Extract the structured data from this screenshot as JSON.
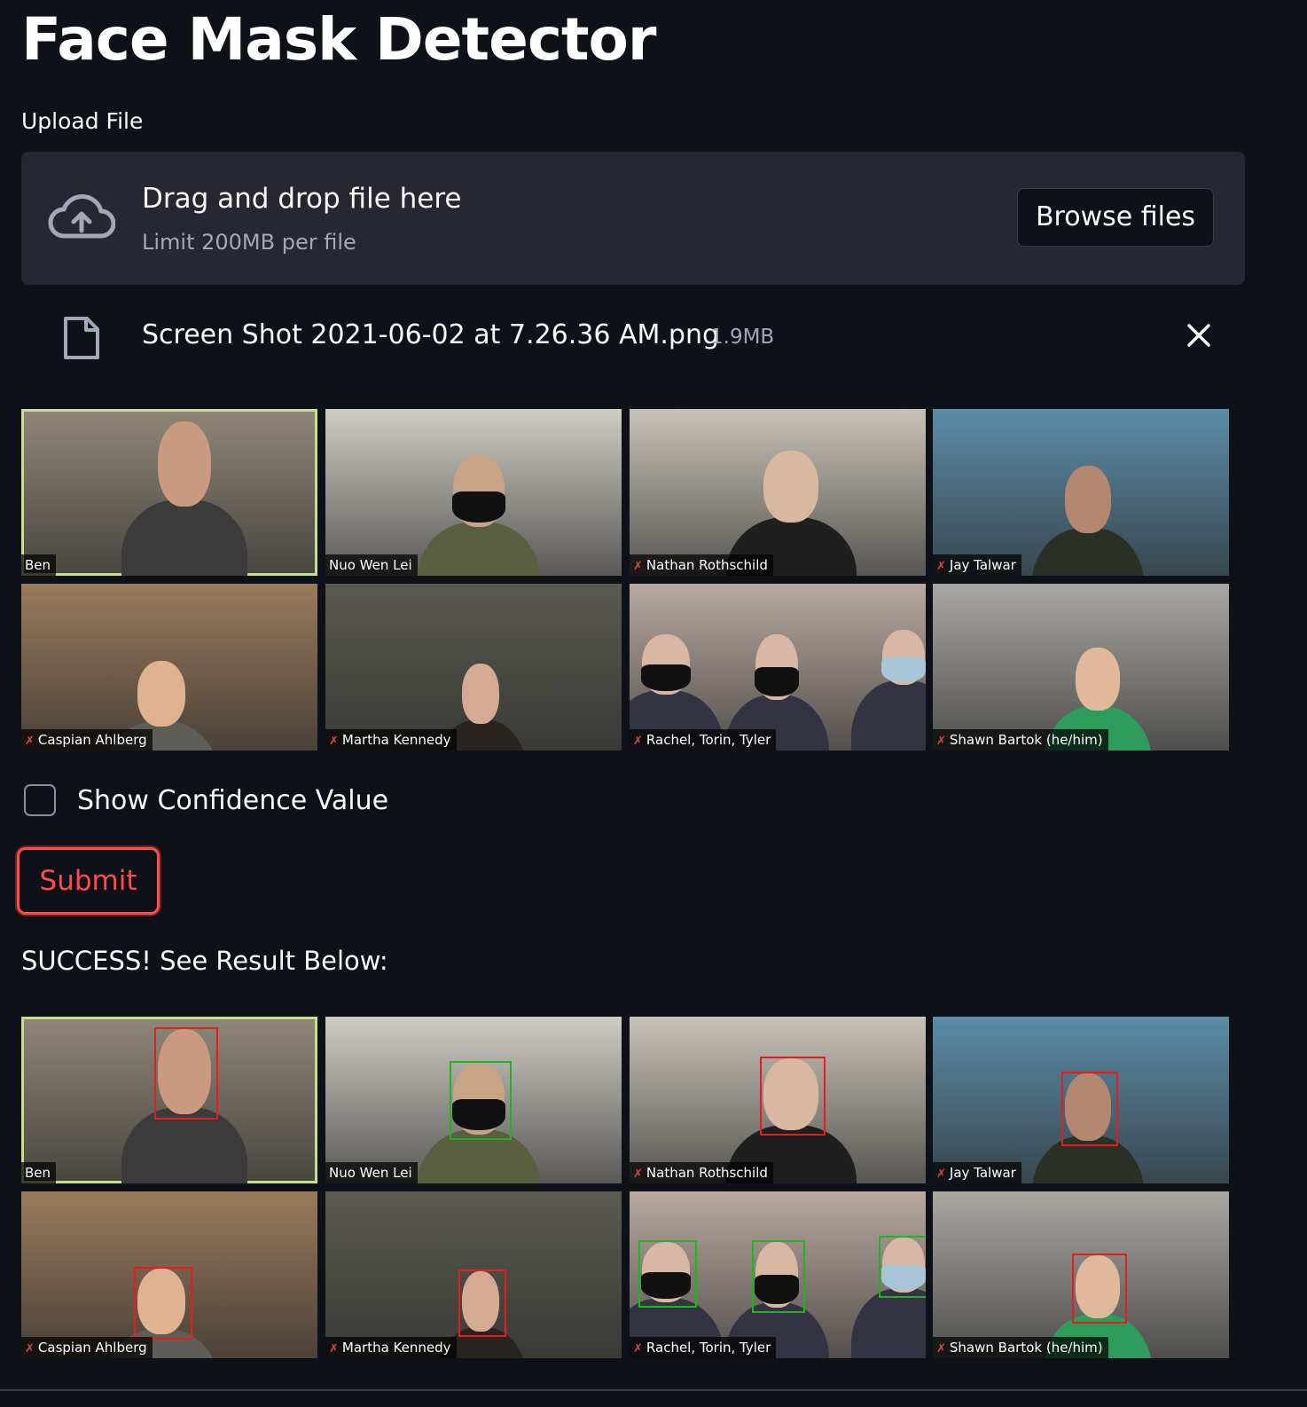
{
  "page": {
    "title": "Face Mask Detector"
  },
  "uploader": {
    "label": "Upload File",
    "drop_text": "Drag and drop file here",
    "limit_text": "Limit 200MB per file",
    "browse_label": "Browse files",
    "file_name": "Screen Shot 2021-06-02 at 7.26.36 AM.png",
    "file_size": "1.9MB"
  },
  "participants": [
    {
      "name": "Ben",
      "muted": false,
      "active": true,
      "bg": "#8f8778",
      "skin": "#c99a80",
      "shirt": "#3b3b3b",
      "masked": false
    },
    {
      "name": "Nuo Wen Lei",
      "muted": false,
      "active": false,
      "bg": "#cfccc4",
      "skin": "#c8a487",
      "shirt": "#5a5f3f",
      "masked": true
    },
    {
      "name": "Nathan Rothschild",
      "muted": true,
      "active": false,
      "bg": "#c8c3b8",
      "skin": "#d8b8a0",
      "shirt": "#1f1f1f",
      "masked": false
    },
    {
      "name": "Jay Talwar",
      "muted": true,
      "active": false,
      "bg": "#5b8ca8",
      "skin": "#b48870",
      "shirt": "#2a3026",
      "masked": false
    },
    {
      "name": "Caspian Ahlberg",
      "muted": true,
      "active": false,
      "bg": "#9a7a5c",
      "skin": "#e0b290",
      "shirt": "#5f5d58",
      "masked": false
    },
    {
      "name": "Martha Kennedy",
      "muted": true,
      "active": false,
      "bg": "#5b5b52",
      "skin": "#d4aa92",
      "shirt": "#2a2420",
      "masked": false
    },
    {
      "name": "Rachel, Torin, Tyler",
      "muted": true,
      "active": false,
      "bg": "#b9a9a0",
      "skin": "#d8b8a4",
      "shirt": "#333344",
      "masked": true
    },
    {
      "name": "Shawn Bartok (he/him)",
      "muted": true,
      "active": false,
      "bg": "#a9a7a2",
      "skin": "#e0b89a",
      "shirt": "#2e9c5a",
      "masked": false
    }
  ],
  "checkbox": {
    "label": "Show Confidence Value",
    "checked": false
  },
  "submit_label": "Submit",
  "result_text": "SUCCESS! See Result Below:",
  "colors": {
    "accent": "#ff4b4b",
    "no_mask_box": "#e81c1c",
    "mask_box": "#21b320",
    "active_speaker": "#c9e08a"
  }
}
